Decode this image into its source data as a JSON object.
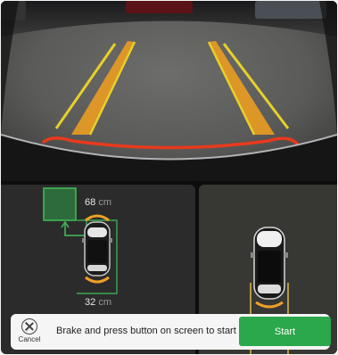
{
  "sensors": {
    "front_distance": {
      "value": "68",
      "unit": "cm"
    },
    "rear_distance": {
      "value": "32",
      "unit": "cm"
    }
  },
  "bottom_bar": {
    "cancel_label": "Cancel",
    "instruction": "Brake and press button on screen to start",
    "start_label": "Start"
  },
  "colors": {
    "start_button": "#2ca84c",
    "parking_spot_outline": "#3fbf5a",
    "guide_line_yellow": "#e7d02a",
    "guide_line_orange": "#f0a028",
    "guide_line_red": "#e83a1c"
  }
}
